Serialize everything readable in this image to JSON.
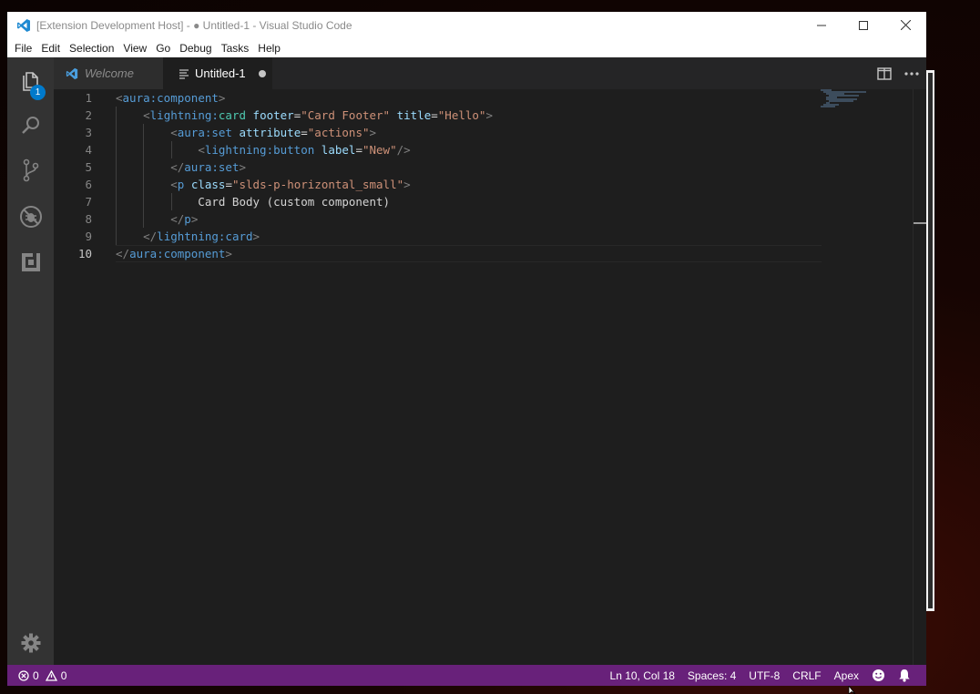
{
  "window": {
    "title": "[Extension Development Host] - ● Untitled-1 - Visual Studio Code",
    "controls": [
      "minimize",
      "maximize",
      "close"
    ]
  },
  "menu": {
    "items": [
      "File",
      "Edit",
      "Selection",
      "View",
      "Go",
      "Debug",
      "Tasks",
      "Help"
    ]
  },
  "activity_bar": {
    "explorer_badge": "1",
    "icons": [
      "files-icon",
      "search-icon",
      "source-control-icon",
      "debug-icon",
      "extensions-icon",
      "settings-gear-icon"
    ]
  },
  "tabs": [
    {
      "label": "Welcome",
      "active": false
    },
    {
      "label": "Untitled-1",
      "active": true,
      "dirty": true
    }
  ],
  "editor": {
    "line_numbers": [
      "1",
      "2",
      "3",
      "4",
      "5",
      "6",
      "7",
      "8",
      "9",
      "10"
    ],
    "current_line": "10"
  },
  "status": {
    "errors": "0",
    "warnings": "0",
    "position": "Ln 10, Col 18",
    "spaces": "Spaces: 4",
    "encoding": "UTF-8",
    "eol": "CRLF",
    "language": "Apex"
  },
  "colors": {
    "status_bar": "#68217a",
    "activity_bar": "#333333",
    "editor_bg": "#1e1e1e",
    "badge": "#007acc"
  }
}
